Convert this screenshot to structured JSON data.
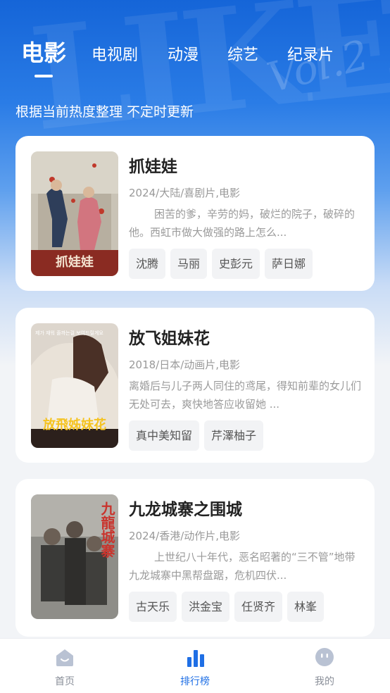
{
  "tabs": [
    {
      "label": "电影"
    },
    {
      "label": "电视剧"
    },
    {
      "label": "动漫"
    },
    {
      "label": "综艺"
    },
    {
      "label": "纪录片"
    }
  ],
  "subtitle": "根据当前热度整理 不定时更新",
  "watermark": {
    "big": "LIKE",
    "script": "Vol.2"
  },
  "movies": [
    {
      "title": "抓娃娃",
      "meta": "2024/大陆/喜剧片,电影",
      "description": "困苦的爹，辛劳的妈，破烂的院子，破碎的他。西虹市做大做强的路上怎么...",
      "actors": [
        "沈腾",
        "马丽",
        "史彭元",
        "萨日娜"
      ],
      "poster_text": "抓娃娃",
      "poster_colors": [
        "#c7c2b6",
        "#8a2b22"
      ]
    },
    {
      "title": "放飞姐妹花",
      "meta": "2018/日本/动画片,电影",
      "description": "离婚后与儿子两人同住的鸢尾，得知前辈的女儿们无处可去，爽快地答应收留她 ...",
      "actors": [
        "真中美知留",
        "芹澤柚子"
      ],
      "poster_text": "放飛姊妹花",
      "poster_top": "제가 재워 줄까는걸 보여드릴게요",
      "poster_colors": [
        "#d9d3cc",
        "#3a2a24"
      ]
    },
    {
      "title": "九龙城寨之围城",
      "meta": "2024/香港/动作片,电影",
      "description": "上世纪八十年代，恶名昭著的“三不管”地带九龙城寨中黑帮盘踞，危机四伏...",
      "actors": [
        "古天乐",
        "洪金宝",
        "任贤齐",
        "林峯"
      ],
      "poster_text": "九龍城寨",
      "poster_colors": [
        "#9a9a96",
        "#3b3a38"
      ]
    }
  ],
  "nav": [
    {
      "label": "首页",
      "icon": "home-icon"
    },
    {
      "label": "排行榜",
      "icon": "chart-icon"
    },
    {
      "label": "我的",
      "icon": "smile-icon"
    }
  ],
  "colors": {
    "accent": "#1f6fe5",
    "header": "#1565d8"
  }
}
